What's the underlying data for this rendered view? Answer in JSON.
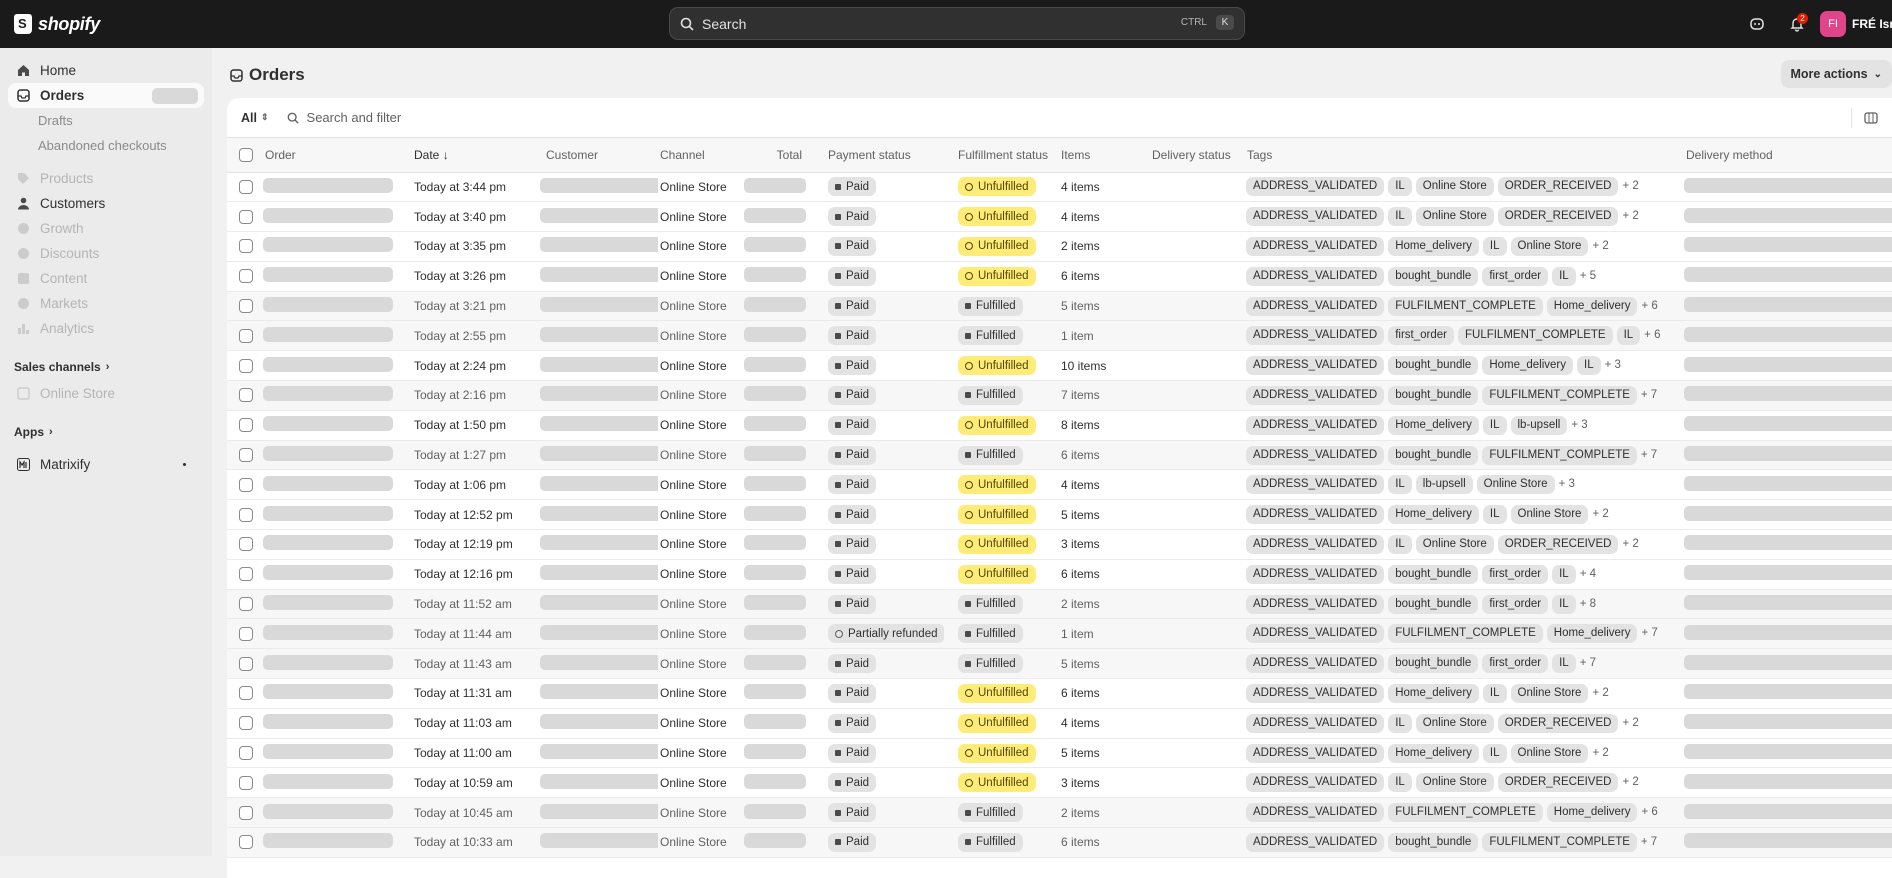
{
  "topbar": {
    "brand": "shopify",
    "search_placeholder": "Search",
    "kbd_ctrl": "CTRL",
    "kbd_k": "K",
    "notification_count": "2",
    "avatar_initials": "FI",
    "store_name": "FRÉ Isra"
  },
  "sidebar": {
    "items": [
      {
        "label": "Home",
        "icon": "home-icon",
        "state": "normal"
      },
      {
        "label": "Orders",
        "icon": "orders-icon",
        "state": "active"
      },
      {
        "label": "Drafts",
        "state": "sub"
      },
      {
        "label": "Abandoned checkouts",
        "state": "sub"
      },
      {
        "label": "Products",
        "icon": "tag-icon",
        "state": "disabled"
      },
      {
        "label": "Customers",
        "icon": "person-icon",
        "state": "normal"
      },
      {
        "label": "Growth",
        "icon": "growth-icon",
        "state": "disabled"
      },
      {
        "label": "Discounts",
        "icon": "discount-icon",
        "state": "disabled"
      },
      {
        "label": "Content",
        "icon": "content-icon",
        "state": "disabled"
      },
      {
        "label": "Markets",
        "icon": "globe-icon",
        "state": "disabled"
      },
      {
        "label": "Analytics",
        "icon": "chart-icon",
        "state": "disabled"
      }
    ],
    "sales_channels_label": "Sales channels",
    "online_store_label": "Online Store",
    "apps_label": "Apps",
    "matrixify_label": "Matrixify"
  },
  "page": {
    "title": "Orders",
    "more_actions": "More actions",
    "filter_all": "All",
    "filter_placeholder": "Search and filter"
  },
  "table": {
    "headers": {
      "order": "Order",
      "date": "Date",
      "customer": "Customer",
      "channel": "Channel",
      "total": "Total",
      "payment": "Payment status",
      "fulfillment": "Fulfillment status",
      "items": "Items",
      "delivery_status": "Delivery status",
      "tags": "Tags",
      "delivery_method": "Delivery method"
    },
    "rows": [
      {
        "date": "Today at 3:44 pm",
        "channel": "Online Store",
        "payment": "Paid",
        "fulfillment": "Unfulfilled",
        "items": "4 items",
        "tags": [
          "ADDRESS_VALIDATED",
          "IL",
          "Online Store",
          "ORDER_RECEIVED"
        ],
        "more": "+ 2"
      },
      {
        "date": "Today at 3:40 pm",
        "channel": "Online Store",
        "payment": "Paid",
        "fulfillment": "Unfulfilled",
        "items": "4 items",
        "tags": [
          "ADDRESS_VALIDATED",
          "IL",
          "Online Store",
          "ORDER_RECEIVED"
        ],
        "more": "+ 2"
      },
      {
        "date": "Today at 3:35 pm",
        "channel": "Online Store",
        "payment": "Paid",
        "fulfillment": "Unfulfilled",
        "items": "2 items",
        "tags": [
          "ADDRESS_VALIDATED",
          "Home_delivery",
          "IL",
          "Online Store"
        ],
        "more": "+ 2"
      },
      {
        "date": "Today at 3:26 pm",
        "channel": "Online Store",
        "payment": "Paid",
        "fulfillment": "Unfulfilled",
        "items": "6 items",
        "tags": [
          "ADDRESS_VALIDATED",
          "bought_bundle",
          "first_order",
          "IL"
        ],
        "more": "+ 5"
      },
      {
        "date": "Today at 3:21 pm",
        "channel": "Online Store",
        "payment": "Paid",
        "fulfillment": "Fulfilled",
        "items": "5 items",
        "tags": [
          "ADDRESS_VALIDATED",
          "FULFILMENT_COMPLETE",
          "Home_delivery"
        ],
        "more": "+ 6"
      },
      {
        "date": "Today at 2:55 pm",
        "channel": "Online Store",
        "payment": "Paid",
        "fulfillment": "Fulfilled",
        "items": "1 item",
        "tags": [
          "ADDRESS_VALIDATED",
          "first_order",
          "FULFILMENT_COMPLETE",
          "IL"
        ],
        "more": "+ 6"
      },
      {
        "date": "Today at 2:24 pm",
        "channel": "Online Store",
        "payment": "Paid",
        "fulfillment": "Unfulfilled",
        "items": "10 items",
        "tags": [
          "ADDRESS_VALIDATED",
          "bought_bundle",
          "Home_delivery",
          "IL"
        ],
        "more": "+ 3"
      },
      {
        "date": "Today at 2:16 pm",
        "channel": "Online Store",
        "payment": "Paid",
        "fulfillment": "Fulfilled",
        "items": "7 items",
        "tags": [
          "ADDRESS_VALIDATED",
          "bought_bundle",
          "FULFILMENT_COMPLETE"
        ],
        "more": "+ 7"
      },
      {
        "date": "Today at 1:50 pm",
        "channel": "Online Store",
        "payment": "Paid",
        "fulfillment": "Unfulfilled",
        "items": "8 items",
        "tags": [
          "ADDRESS_VALIDATED",
          "Home_delivery",
          "IL",
          "lb-upsell"
        ],
        "more": "+ 3"
      },
      {
        "date": "Today at 1:27 pm",
        "channel": "Online Store",
        "payment": "Paid",
        "fulfillment": "Fulfilled",
        "items": "6 items",
        "tags": [
          "ADDRESS_VALIDATED",
          "bought_bundle",
          "FULFILMENT_COMPLETE"
        ],
        "more": "+ 7"
      },
      {
        "date": "Today at 1:06 pm",
        "channel": "Online Store",
        "payment": "Paid",
        "fulfillment": "Unfulfilled",
        "items": "4 items",
        "tags": [
          "ADDRESS_VALIDATED",
          "IL",
          "lb-upsell",
          "Online Store"
        ],
        "more": "+ 3"
      },
      {
        "date": "Today at 12:52 pm",
        "channel": "Online Store",
        "payment": "Paid",
        "fulfillment": "Unfulfilled",
        "items": "5 items",
        "tags": [
          "ADDRESS_VALIDATED",
          "Home_delivery",
          "IL",
          "Online Store"
        ],
        "more": "+ 2"
      },
      {
        "date": "Today at 12:19 pm",
        "channel": "Online Store",
        "payment": "Paid",
        "fulfillment": "Unfulfilled",
        "items": "3 items",
        "tags": [
          "ADDRESS_VALIDATED",
          "IL",
          "Online Store",
          "ORDER_RECEIVED"
        ],
        "more": "+ 2"
      },
      {
        "date": "Today at 12:16 pm",
        "channel": "Online Store",
        "payment": "Paid",
        "fulfillment": "Unfulfilled",
        "items": "6 items",
        "tags": [
          "ADDRESS_VALIDATED",
          "bought_bundle",
          "first_order",
          "IL"
        ],
        "more": "+ 4"
      },
      {
        "date": "Today at 11:52 am",
        "channel": "Online Store",
        "payment": "Paid",
        "fulfillment": "Fulfilled",
        "items": "2 items",
        "tags": [
          "ADDRESS_VALIDATED",
          "bought_bundle",
          "first_order",
          "IL"
        ],
        "more": "+ 8"
      },
      {
        "date": "Today at 11:44 am",
        "channel": "Online Store",
        "payment": "Partially refunded",
        "fulfillment": "Fulfilled",
        "items": "1 item",
        "tags": [
          "ADDRESS_VALIDATED",
          "FULFILMENT_COMPLETE",
          "Home_delivery"
        ],
        "more": "+ 7"
      },
      {
        "date": "Today at 11:43 am",
        "channel": "Online Store",
        "payment": "Paid",
        "fulfillment": "Fulfilled",
        "items": "5 items",
        "tags": [
          "ADDRESS_VALIDATED",
          "bought_bundle",
          "first_order",
          "IL"
        ],
        "more": "+ 7"
      },
      {
        "date": "Today at 11:31 am",
        "channel": "Online Store",
        "payment": "Paid",
        "fulfillment": "Unfulfilled",
        "items": "6 items",
        "tags": [
          "ADDRESS_VALIDATED",
          "Home_delivery",
          "IL",
          "Online Store"
        ],
        "more": "+ 2"
      },
      {
        "date": "Today at 11:03 am",
        "channel": "Online Store",
        "payment": "Paid",
        "fulfillment": "Unfulfilled",
        "items": "4 items",
        "tags": [
          "ADDRESS_VALIDATED",
          "IL",
          "Online Store",
          "ORDER_RECEIVED"
        ],
        "more": "+ 2"
      },
      {
        "date": "Today at 11:00 am",
        "channel": "Online Store",
        "payment": "Paid",
        "fulfillment": "Unfulfilled",
        "items": "5 items",
        "tags": [
          "ADDRESS_VALIDATED",
          "Home_delivery",
          "IL",
          "Online Store"
        ],
        "more": "+ 2"
      },
      {
        "date": "Today at 10:59 am",
        "channel": "Online Store",
        "payment": "Paid",
        "fulfillment": "Unfulfilled",
        "items": "3 items",
        "tags": [
          "ADDRESS_VALIDATED",
          "IL",
          "Online Store",
          "ORDER_RECEIVED"
        ],
        "more": "+ 2"
      },
      {
        "date": "Today at 10:45 am",
        "channel": "Online Store",
        "payment": "Paid",
        "fulfillment": "Fulfilled",
        "items": "2 items",
        "tags": [
          "ADDRESS_VALIDATED",
          "FULFILMENT_COMPLETE",
          "Home_delivery"
        ],
        "more": "+ 6"
      },
      {
        "date": "Today at 10:33 am",
        "channel": "Online Store",
        "payment": "Paid",
        "fulfillment": "Fulfilled",
        "items": "6 items",
        "tags": [
          "ADDRESS_VALIDATED",
          "bought_bundle",
          "FULFILMENT_COMPLETE"
        ],
        "more": "+ 7"
      }
    ]
  },
  "colors": {
    "topbar": "#1a1a1a",
    "unfulfilled_badge": "#ffeb78",
    "avatar": "#e0458a"
  }
}
